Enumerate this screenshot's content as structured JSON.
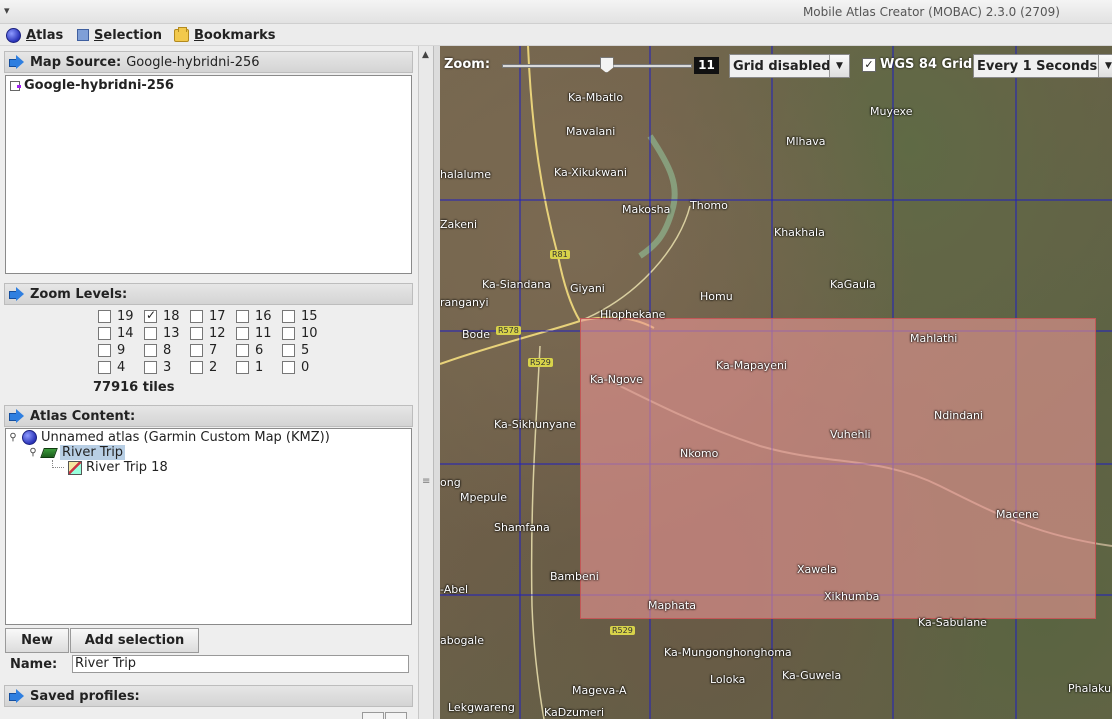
{
  "window": {
    "title": "Mobile Atlas Creator (MOBAC) 2.3.0 (2709)",
    "system_menu": "▾"
  },
  "menubar": {
    "items": [
      {
        "label": "Atlas",
        "icon": "globe-icon"
      },
      {
        "label": "Selection",
        "icon": "selection-icon"
      },
      {
        "label": "Bookmarks",
        "icon": "bookmark-icon"
      }
    ]
  },
  "map_source": {
    "header": "Map Source:",
    "value": "Google-hybridni-256",
    "list_item": "Google-hybridni-256"
  },
  "zoom_levels": {
    "header": "Zoom Levels:",
    "levels": [
      {
        "label": "19",
        "checked": false
      },
      {
        "label": "18",
        "checked": true
      },
      {
        "label": "17",
        "checked": false
      },
      {
        "label": "16",
        "checked": false
      },
      {
        "label": "15",
        "checked": false
      },
      {
        "label": "14",
        "checked": false
      },
      {
        "label": "13",
        "checked": false
      },
      {
        "label": "12",
        "checked": false
      },
      {
        "label": "11",
        "checked": false
      },
      {
        "label": "10",
        "checked": false
      },
      {
        "label": "9",
        "checked": false
      },
      {
        "label": "8",
        "checked": false
      },
      {
        "label": "7",
        "checked": false
      },
      {
        "label": "6",
        "checked": false
      },
      {
        "label": "5",
        "checked": false
      },
      {
        "label": "4",
        "checked": false
      },
      {
        "label": "3",
        "checked": false
      },
      {
        "label": "2",
        "checked": false
      },
      {
        "label": "1",
        "checked": false
      },
      {
        "label": "0",
        "checked": false
      }
    ],
    "tiles": "77916 tiles"
  },
  "atlas_content": {
    "header": "Atlas Content:",
    "atlas": "Unnamed atlas (Garmin Custom Map (KMZ))",
    "layer": "River Trip",
    "map": "River Trip 18"
  },
  "actions": {
    "new_label": "New",
    "add_selection_label": "Add selection"
  },
  "name_field": {
    "label": "Name:",
    "value": "River Trip"
  },
  "saved_profiles": {
    "header": "Saved profiles:"
  },
  "map_toolbar": {
    "zoom_label": "Zoom:",
    "zoom_value": "11",
    "zoom_fraction": 0.55,
    "grid_select": "Grid disabled",
    "wgs_checked": true,
    "wgs_label": "WGS 84 Grid",
    "interval_select": "Every 1 Seconds"
  },
  "map": {
    "selection_color": "#eb9696",
    "grid_color": "#1f1fbf",
    "places": [
      "Ka-Mbatlo",
      "Muyexe",
      "Mavalani",
      "Mlhava",
      "Ka-Xikukwani",
      "halalume",
      "Thomo",
      "Makosha",
      "Zakeni",
      "Khakhala",
      "Ka-Siandana",
      "Giyani",
      "KaGaula",
      "Homu",
      "ranganyi",
      "Hlophekane",
      "Bode",
      "Mahlathi",
      "Ka-Mapayeni",
      "Ka-Ngove",
      "Ndindani",
      "Ka-Sikhunyane",
      "Vuhehli",
      "Nkomo",
      "ong",
      "Mpepule",
      "Macene",
      "Shamfana",
      "Xawela",
      "Bambeni",
      "-Abel",
      "Xikhumba",
      "Maphata",
      "abogale",
      "Ka-Sabulane",
      "Ka-Mungonghonghoma",
      "Loloka",
      "Ka-Guwela",
      "Phalaku",
      "Mageva-A",
      "Lekgwareng",
      "KaDzumeri"
    ],
    "road_labels": [
      "R81",
      "R578",
      "R529",
      "R529"
    ]
  }
}
